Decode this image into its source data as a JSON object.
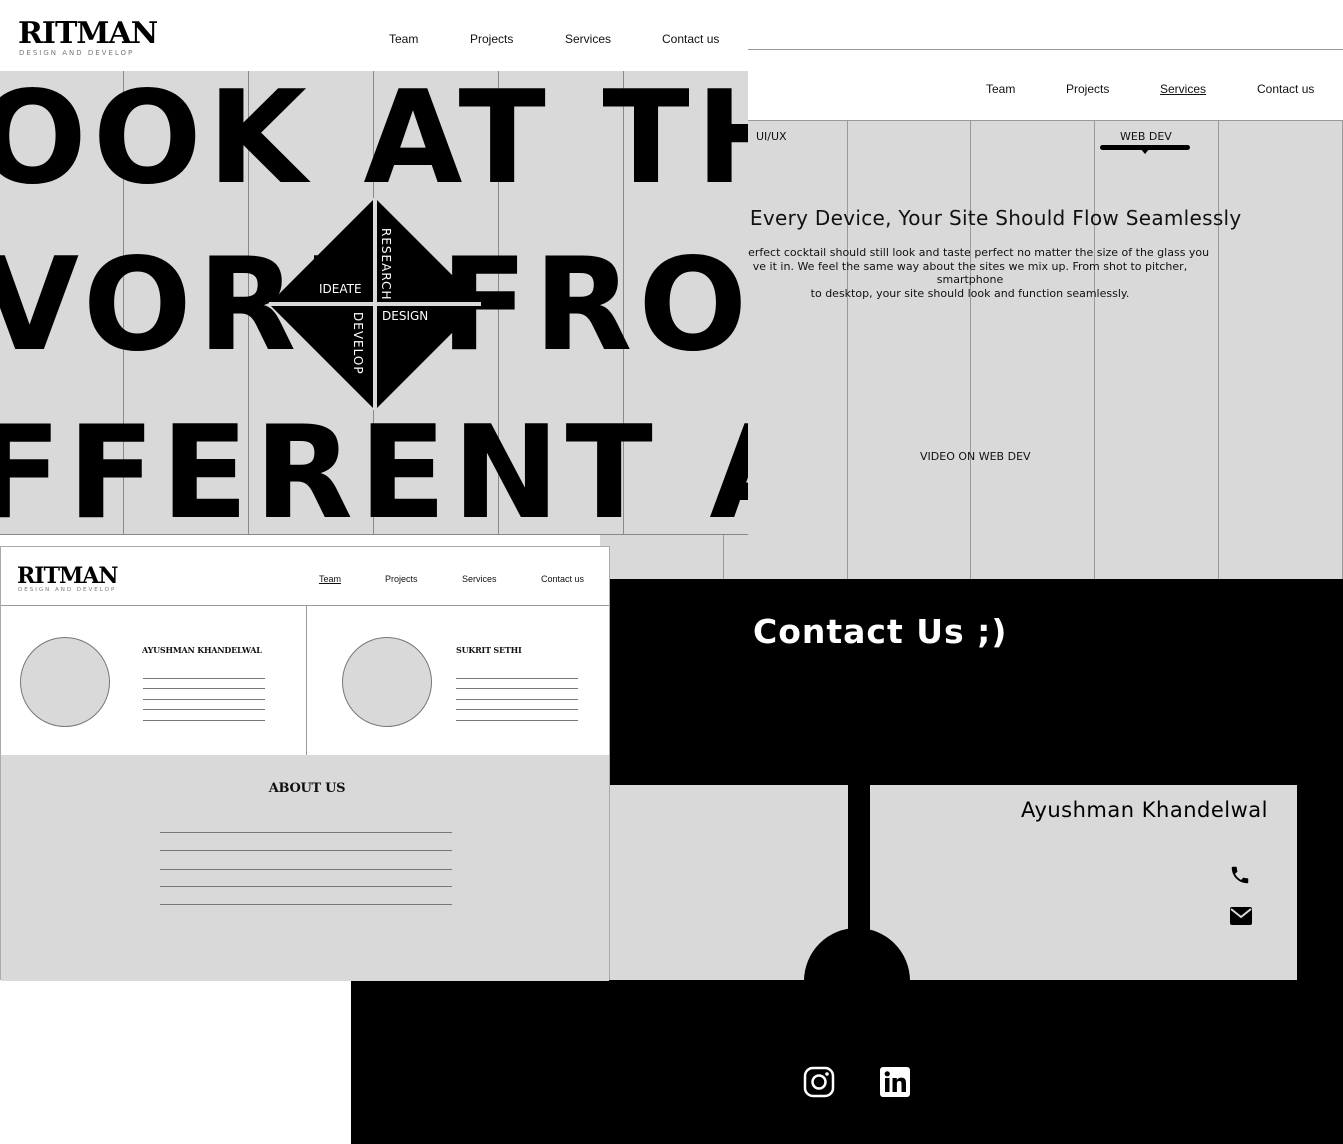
{
  "hero": {
    "logo": "RITMAN",
    "logo_sub": "DESIGN AND DEVELOP",
    "nav": [
      "Team",
      "Projects",
      "Services",
      "Contact us"
    ],
    "lines": [
      "OOK AT THE",
      "VORL  FROM",
      "FFERENT AN"
    ],
    "diamond": {
      "top": "RESEARCH",
      "left": "IDEATE",
      "right": "DESIGN",
      "bottom": "DEVELOP"
    }
  },
  "services": {
    "nav": [
      "Team",
      "Projects",
      "Services",
      "Contact us"
    ],
    "active_nav": "Services",
    "tabs": {
      "uiux": "UI/UX",
      "webdev": "WEB DEV"
    },
    "heading": "re & Every Device, Your Site Should Flow Seamlessly",
    "body_lines": [
      "e perfect cocktail should still look and taste perfect no matter the size of the glass you",
      "ve it in. We feel the same way about the sites we mix up. From shot to pitcher, smartphone",
      "to desktop, your site should look and function seamlessly."
    ],
    "video_label": "VIDEO ON WEB DEV"
  },
  "team": {
    "logo": "RITMAN",
    "logo_sub": "DESIGN AND DEVELOP",
    "nav": [
      "Team",
      "Projects",
      "Services",
      "Contact us"
    ],
    "active_nav": "Team",
    "members": [
      {
        "name": "AYUSHMAN KHANDELWAL"
      },
      {
        "name": "SUKRIT SETHI"
      }
    ],
    "about_title": "ABOUT US"
  },
  "contact": {
    "title": "Contact Us ;)",
    "name": "Ayushman Khandelwal",
    "icons": [
      "phone-icon",
      "mail-icon",
      "instagram-icon",
      "linkedin-icon"
    ]
  },
  "colors": {
    "panel_gray": "#d9d9d9",
    "black": "#000000",
    "white": "#ffffff"
  }
}
